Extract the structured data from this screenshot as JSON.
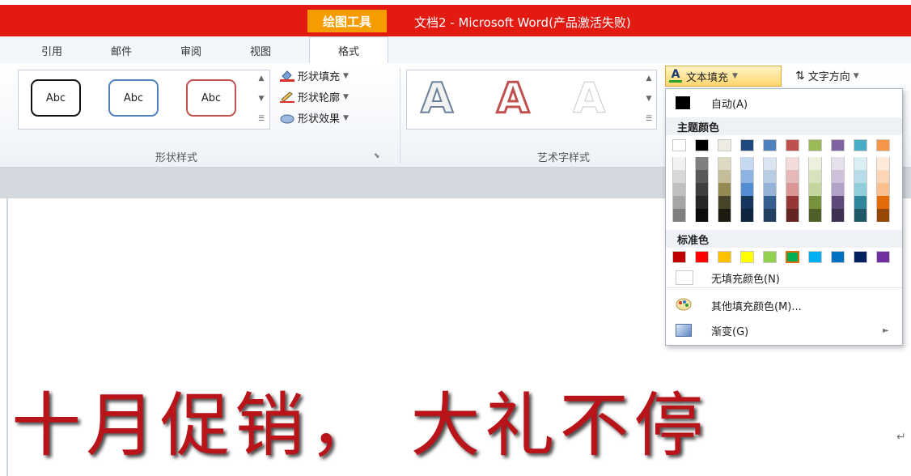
{
  "titlebar": {
    "context_tab": "绘图工具",
    "title": "文档2 - Microsoft Word(产品激活失败)"
  },
  "tabs": [
    "引用",
    "邮件",
    "审阅",
    "视图"
  ],
  "active_tab": "格式",
  "shape_styles": {
    "samples": [
      "Abc",
      "Abc",
      "Abc"
    ],
    "fill": "形状填充",
    "outline": "形状轮廓",
    "effects": "形状效果",
    "group_label": "形状样式"
  },
  "wordart": {
    "samples": [
      "A",
      "A",
      "A"
    ],
    "group_label": "艺术字样式"
  },
  "text_fill_button": "文本填充",
  "text_direction": "文字方向",
  "dropdown": {
    "auto": "自动(A)",
    "theme_colors_label": "主题颜色",
    "standard_colors_label": "标准色",
    "no_fill": "无填充颜色(N)",
    "more_colors": "其他填充颜色(M)...",
    "gradient": "渐变(G)",
    "theme_top": [
      "#ffffff",
      "#000000",
      "#eeece1",
      "#1f497d",
      "#4f81bd",
      "#c0504d",
      "#9bbb59",
      "#8064a2",
      "#4bacc6",
      "#f79646"
    ],
    "theme_shades": [
      [
        "#f2f2f2",
        "#d8d8d8",
        "#bfbfbf",
        "#a5a5a5",
        "#7f7f7f"
      ],
      [
        "#7f7f7f",
        "#595959",
        "#3f3f3f",
        "#262626",
        "#0c0c0c"
      ],
      [
        "#ddd9c3",
        "#c4bd97",
        "#938953",
        "#494429",
        "#1d1b10"
      ],
      [
        "#c6d9f0",
        "#8db3e2",
        "#548dd4",
        "#17365d",
        "#0f243e"
      ],
      [
        "#dbe5f1",
        "#b8cce4",
        "#95b3d7",
        "#366092",
        "#244061"
      ],
      [
        "#f2dcdb",
        "#e5b9b7",
        "#d99694",
        "#953734",
        "#632423"
      ],
      [
        "#ebf1dd",
        "#d7e3bc",
        "#c3d69b",
        "#76923c",
        "#4f6128"
      ],
      [
        "#e5e0ec",
        "#ccc1d9",
        "#b2a2c7",
        "#5f497a",
        "#3f3151"
      ],
      [
        "#dbeef3",
        "#b7dde8",
        "#92cddc",
        "#31859b",
        "#205867"
      ],
      [
        "#fdeada",
        "#fbd5b5",
        "#fac08f",
        "#e36c09",
        "#974806"
      ]
    ],
    "standard": [
      "#c00000",
      "#ff0000",
      "#ffc000",
      "#ffff00",
      "#92d050",
      "#00b050",
      "#00b0f0",
      "#0070c0",
      "#002060",
      "#7030a0"
    ]
  },
  "document": {
    "headline": "十月促销， 大礼不停"
  }
}
